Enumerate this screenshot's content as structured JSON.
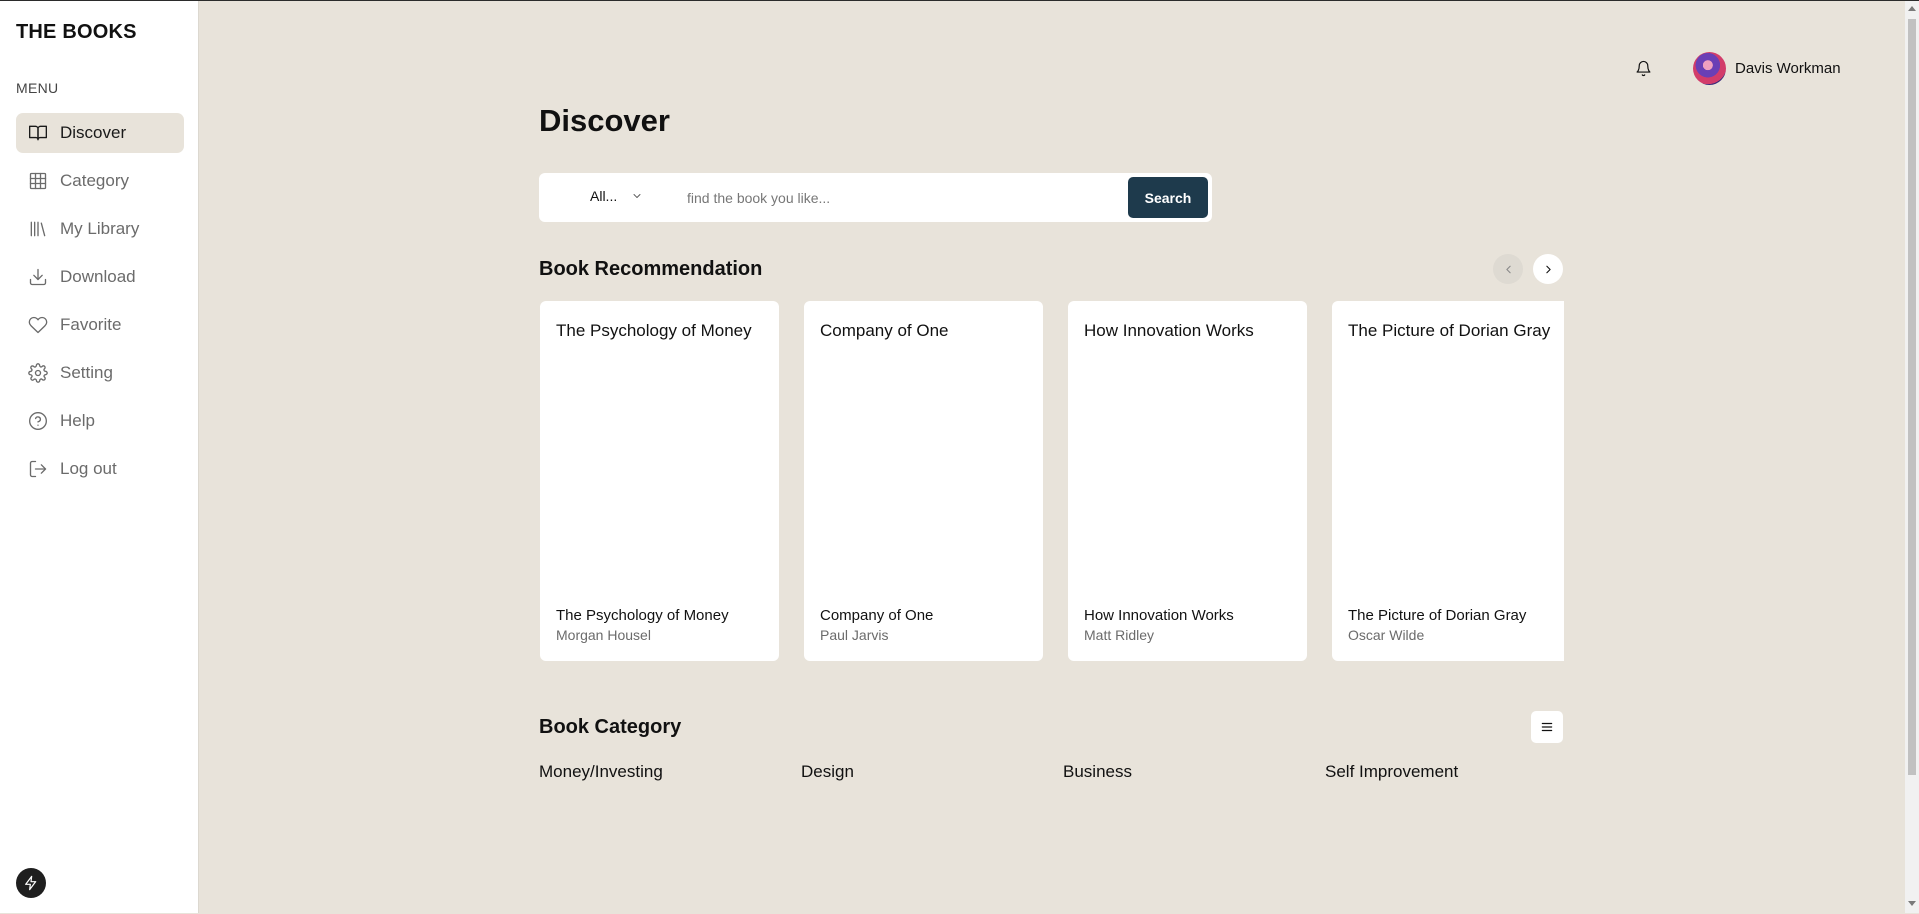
{
  "brand": "THE BOOKS",
  "menu_title": "MENU",
  "nav": [
    {
      "label": "Discover",
      "icon": "book-open-icon"
    },
    {
      "label": "Category",
      "icon": "grid-icon"
    },
    {
      "label": "My Library",
      "icon": "library-icon"
    },
    {
      "label": "Download",
      "icon": "download-icon"
    },
    {
      "label": "Favorite",
      "icon": "heart-icon"
    },
    {
      "label": "Setting",
      "icon": "gear-icon"
    },
    {
      "label": "Help",
      "icon": "help-circle-icon"
    },
    {
      "label": "Log out",
      "icon": "logout-icon"
    }
  ],
  "header": {
    "user_name": "Davis Workman"
  },
  "main": {
    "title": "Discover",
    "search": {
      "category": "All...",
      "placeholder": "find the book you like...",
      "button": "Search"
    },
    "recommendation_title": "Book Recommendation",
    "books": [
      {
        "cover_alt": "The Psychology of Money",
        "title": "The Psychology of Money",
        "author": "Morgan Housel"
      },
      {
        "cover_alt": "Company of One",
        "title": "Company of One",
        "author": "Paul Jarvis"
      },
      {
        "cover_alt": "How Innovation Works",
        "title": "How Innovation Works",
        "author": "Matt Ridley"
      },
      {
        "cover_alt": "The Picture of Dorian Gray",
        "title": "The Picture of Dorian Gray",
        "author": "Oscar Wilde"
      }
    ],
    "category_title": "Book Category",
    "categories": [
      "Money/Investing",
      "Design",
      "Business",
      "Self Improvement"
    ]
  },
  "colors": {
    "background": "#e8e3da",
    "accent": "#1e3a4c",
    "sidebar": "#ffffff"
  }
}
